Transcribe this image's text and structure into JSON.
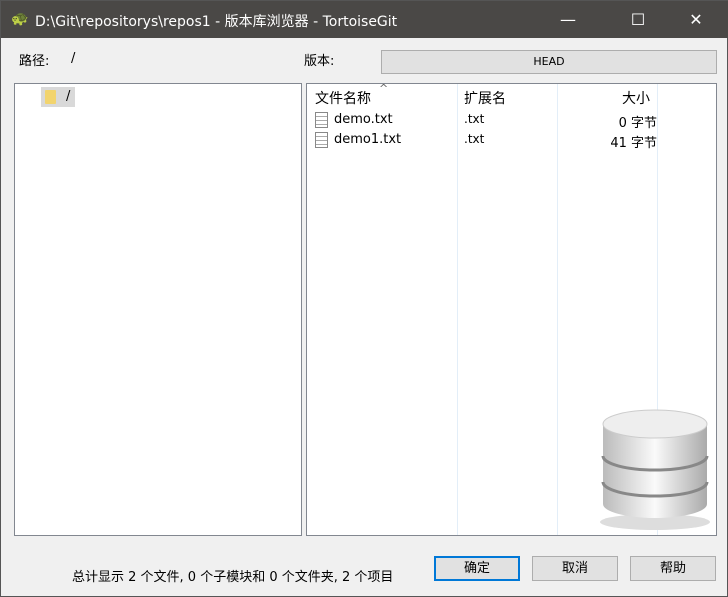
{
  "window": {
    "title": "D:\\Git\\repositorys\\repos1 - 版本库浏览器 - TortoiseGit",
    "minimize": "—",
    "maximize": "☐",
    "close": "✕"
  },
  "path": {
    "label": "路径:",
    "value": "/"
  },
  "revision": {
    "label": "版本:",
    "value": "HEAD"
  },
  "tree": {
    "root": "/"
  },
  "list": {
    "columns": [
      "文件名称",
      "扩展名",
      "大小"
    ],
    "sort_indicator": "^",
    "rows": [
      {
        "name": "demo.txt",
        "ext": ".txt",
        "size": "0 字节"
      },
      {
        "name": "demo1.txt",
        "ext": ".txt",
        "size": "41 字节"
      }
    ]
  },
  "status": "总计显示 2 个文件, 0 个子模块和 0 个文件夹, 2 个项目",
  "buttons": {
    "ok": "确定",
    "cancel": "取消",
    "help": "帮助"
  }
}
